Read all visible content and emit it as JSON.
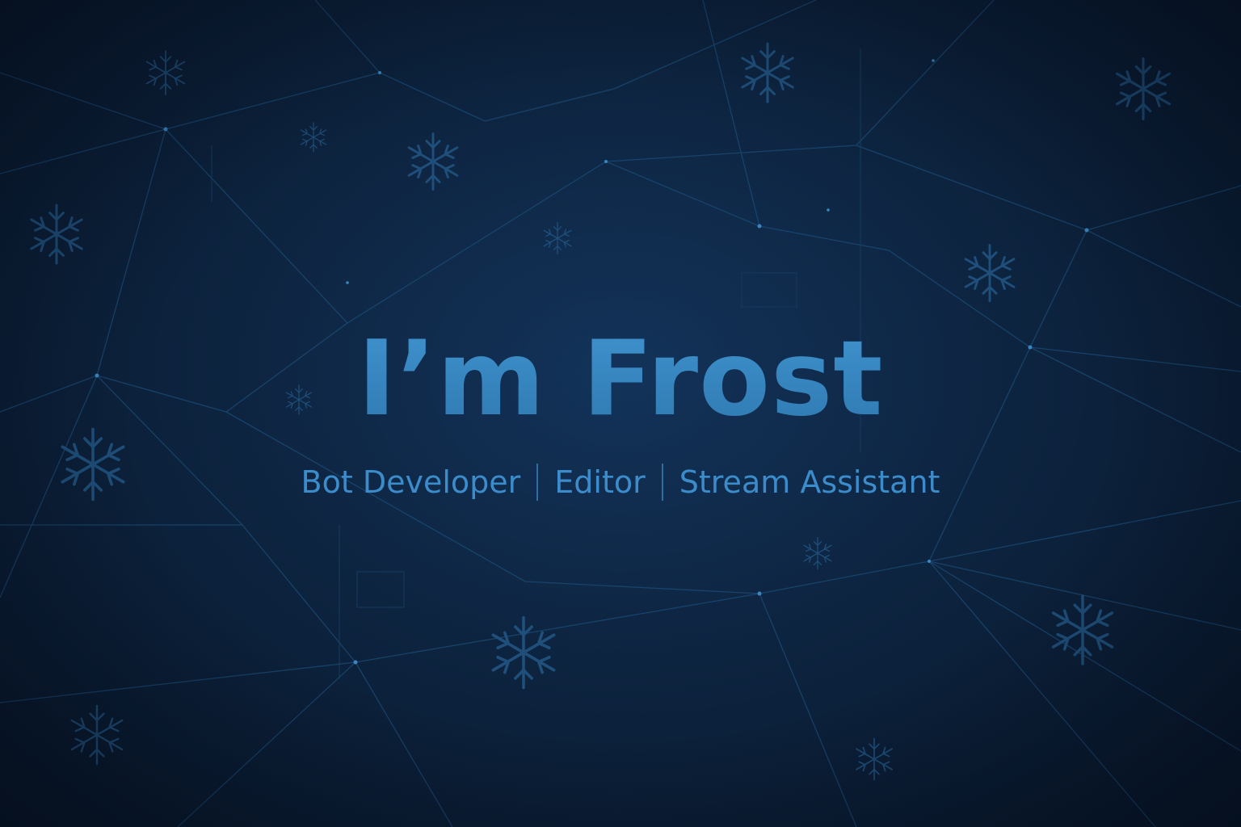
{
  "hero": {
    "title": "I’m Frost",
    "roles": [
      "Bot Developer",
      "Editor",
      "Stream Assistant"
    ]
  },
  "colors": {
    "background": "#0d2440",
    "accent": "#3d8fc9",
    "lines": "#1f4f7a"
  },
  "decorations": {
    "icon": "snowflake-icon",
    "pattern": "network-lines"
  }
}
